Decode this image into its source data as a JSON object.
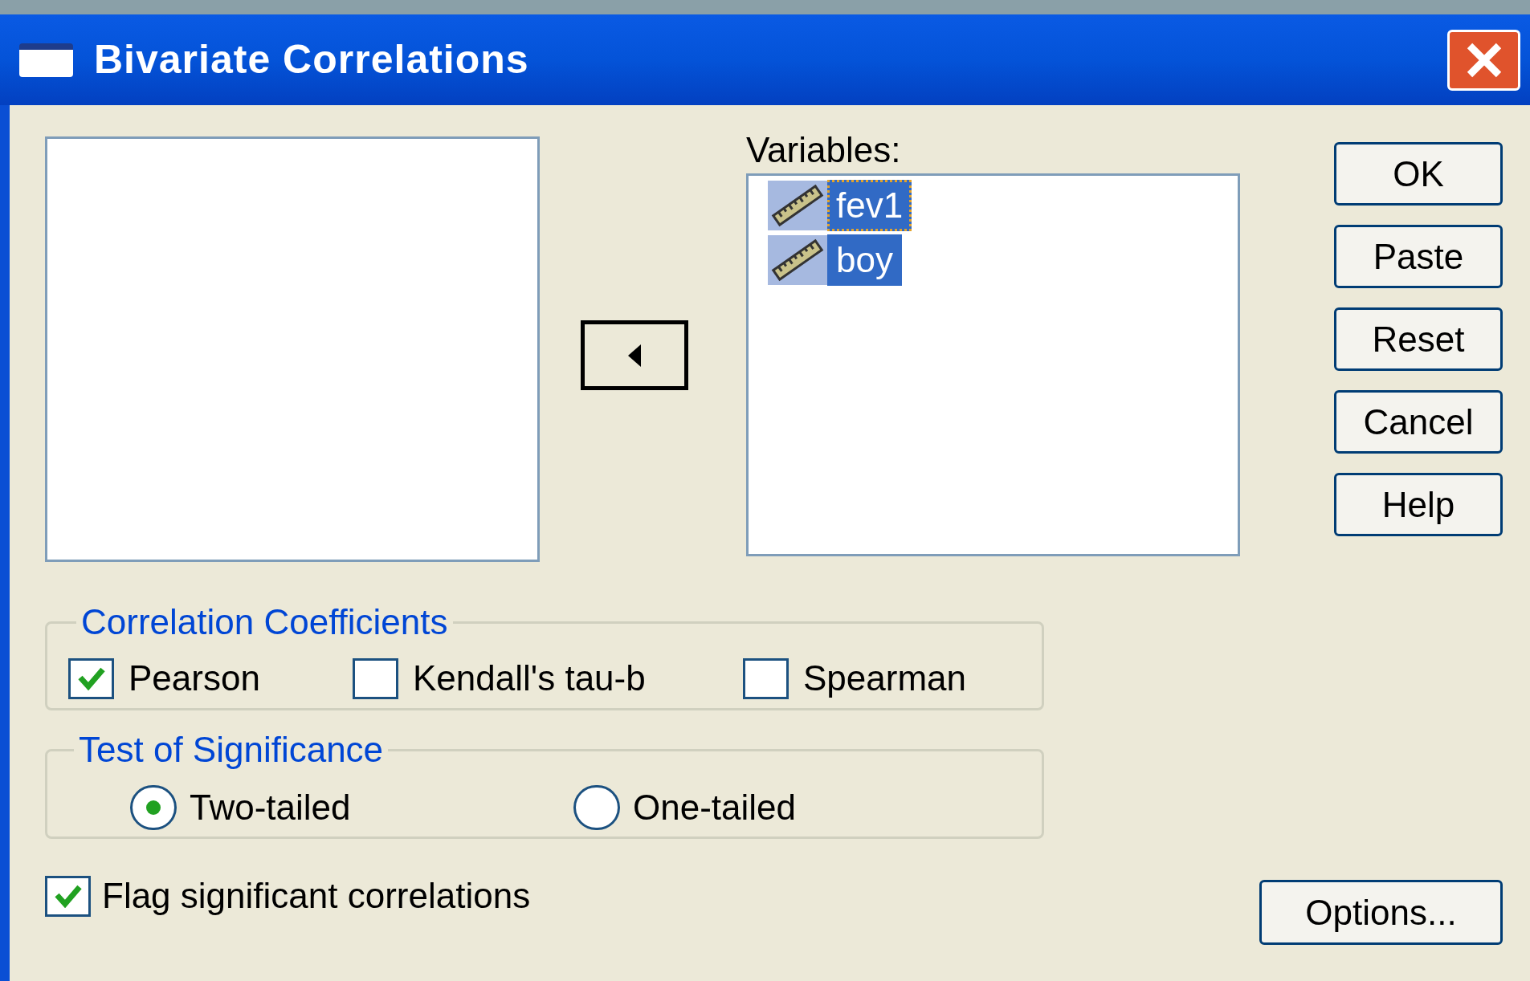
{
  "window": {
    "title": "Bivariate Correlations"
  },
  "variables": {
    "label": "Variables:",
    "items": [
      {
        "name": "fev1",
        "selected": true,
        "focused": true
      },
      {
        "name": "boy",
        "selected": true,
        "focused": false
      }
    ]
  },
  "buttons": [
    {
      "label": "OK"
    },
    {
      "label": "Paste"
    },
    {
      "label": "Reset"
    },
    {
      "label": "Cancel"
    },
    {
      "label": "Help"
    }
  ],
  "correlation_coefficients": {
    "title": "Correlation Coefficients",
    "options": [
      {
        "label": "Pearson",
        "checked": true
      },
      {
        "label": "Kendall's tau-b",
        "checked": false
      },
      {
        "label": "Spearman",
        "checked": false
      }
    ]
  },
  "test_of_significance": {
    "title": "Test of Significance",
    "options": [
      {
        "label": "Two-tailed",
        "selected": true
      },
      {
        "label": "One-tailed",
        "selected": false
      }
    ]
  },
  "flag": {
    "label": "Flag significant correlations",
    "checked": true
  },
  "options_button": {
    "label": "Options..."
  }
}
